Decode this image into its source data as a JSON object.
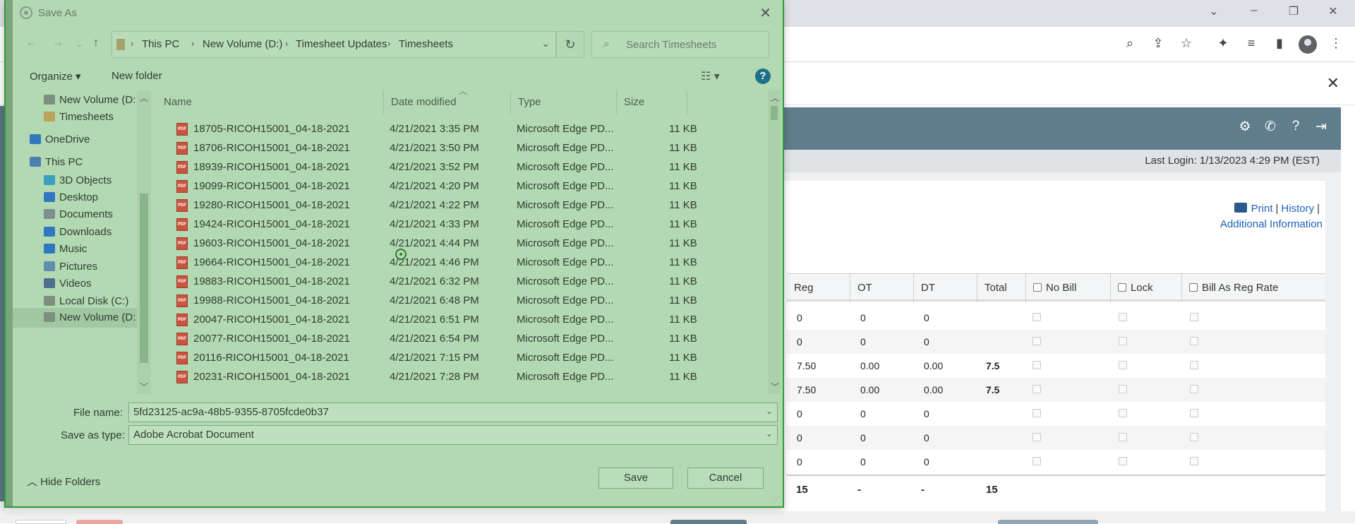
{
  "dialog": {
    "title": "Save As",
    "breadcrumb": [
      "This PC",
      "New Volume (D:)",
      "Timesheet Updates",
      "Timesheets"
    ],
    "search_placeholder": "Search Timesheets",
    "organize_label": "Organize ▾",
    "new_folder_label": "New folder",
    "nav_items": [
      {
        "label": "New Volume (D:",
        "icon": "drive-icon"
      },
      {
        "label": "Timesheets",
        "icon": "folder-icon"
      },
      {
        "label": "OneDrive",
        "icon": "cloud-icon"
      },
      {
        "label": "This PC",
        "icon": "computer-icon"
      },
      {
        "label": "3D Objects",
        "icon": "3d-objects-icon"
      },
      {
        "label": "Desktop",
        "icon": "desktop-icon"
      },
      {
        "label": "Documents",
        "icon": "documents-icon"
      },
      {
        "label": "Downloads",
        "icon": "downloads-icon"
      },
      {
        "label": "Music",
        "icon": "music-icon"
      },
      {
        "label": "Pictures",
        "icon": "pictures-icon"
      },
      {
        "label": "Videos",
        "icon": "videos-icon"
      },
      {
        "label": "Local Disk (C:)",
        "icon": "drive-icon"
      },
      {
        "label": "New Volume (D:",
        "icon": "drive-icon"
      }
    ],
    "columns": {
      "name": "Name",
      "date": "Date modified",
      "type": "Type",
      "size": "Size"
    },
    "files": [
      {
        "name": "18705-RICOH15001_04-18-2021",
        "date": "4/21/2021 3:35 PM",
        "type": "Microsoft Edge PD...",
        "size": "11 KB"
      },
      {
        "name": "18706-RICOH15001_04-18-2021",
        "date": "4/21/2021 3:50 PM",
        "type": "Microsoft Edge PD...",
        "size": "11 KB"
      },
      {
        "name": "18939-RICOH15001_04-18-2021",
        "date": "4/21/2021 3:52 PM",
        "type": "Microsoft Edge PD...",
        "size": "11 KB"
      },
      {
        "name": "19099-RICOH15001_04-18-2021",
        "date": "4/21/2021 4:20 PM",
        "type": "Microsoft Edge PD...",
        "size": "11 KB"
      },
      {
        "name": "19280-RICOH15001_04-18-2021",
        "date": "4/21/2021 4:22 PM",
        "type": "Microsoft Edge PD...",
        "size": "11 KB"
      },
      {
        "name": "19424-RICOH15001_04-18-2021",
        "date": "4/21/2021 4:33 PM",
        "type": "Microsoft Edge PD...",
        "size": "11 KB"
      },
      {
        "name": "19603-RICOH15001_04-18-2021",
        "date": "4/21/2021 4:44 PM",
        "type": "Microsoft Edge PD...",
        "size": "11 KB"
      },
      {
        "name": "19664-RICOH15001_04-18-2021",
        "date": "4/21/2021 4:46 PM",
        "type": "Microsoft Edge PD...",
        "size": "11 KB"
      },
      {
        "name": "19883-RICOH15001_04-18-2021",
        "date": "4/21/2021 6:32 PM",
        "type": "Microsoft Edge PD...",
        "size": "11 KB"
      },
      {
        "name": "19988-RICOH15001_04-18-2021",
        "date": "4/21/2021 6:48 PM",
        "type": "Microsoft Edge PD...",
        "size": "11 KB"
      },
      {
        "name": "20047-RICOH15001_04-18-2021",
        "date": "4/21/2021 6:51 PM",
        "type": "Microsoft Edge PD...",
        "size": "11 KB"
      },
      {
        "name": "20077-RICOH15001_04-18-2021",
        "date": "4/21/2021 6:54 PM",
        "type": "Microsoft Edge PD...",
        "size": "11 KB"
      },
      {
        "name": "20116-RICOH15001_04-18-2021",
        "date": "4/21/2021 7:15 PM",
        "type": "Microsoft Edge PD...",
        "size": "11 KB"
      },
      {
        "name": "20231-RICOH15001_04-18-2021",
        "date": "4/21/2021 7:28 PM",
        "type": "Microsoft Edge PD...",
        "size": "11 KB"
      }
    ],
    "file_name_label": "File name:",
    "file_name_value": "5fd23125-ac9a-48b5-9355-8705fcde0b37",
    "save_type_label": "Save as type:",
    "save_type_value": "Adobe Acrobat Document",
    "hide_folders_label": "Hide Folders",
    "save_label": "Save",
    "cancel_label": "Cancel"
  },
  "page": {
    "last_login": "Last Login: 1/13/2023 4:29 PM (EST)",
    "print_label": "Print",
    "history_label": "History",
    "additional_info_label": "Additional Information",
    "table_headers": {
      "reg": "Reg",
      "ot": "OT",
      "dt": "DT",
      "total": "Total",
      "no_bill": "No Bill",
      "lock": "Lock",
      "bill_reg": "Bill As Reg Rate"
    },
    "rows": [
      {
        "reg": "0",
        "ot": "0",
        "dt": "0",
        "total": ""
      },
      {
        "reg": "0",
        "ot": "0",
        "dt": "0",
        "total": ""
      },
      {
        "reg": "7.50",
        "ot": "0.00",
        "dt": "0.00",
        "total": "7.5"
      },
      {
        "reg": "7.50",
        "ot": "0.00",
        "dt": "0.00",
        "total": "7.5"
      },
      {
        "reg": "0",
        "ot": "0",
        "dt": "0",
        "total": ""
      },
      {
        "reg": "0",
        "ot": "0",
        "dt": "0",
        "total": ""
      },
      {
        "reg": "0",
        "ot": "0",
        "dt": "0",
        "total": ""
      }
    ],
    "totals": {
      "reg": "15",
      "ot": "-",
      "dt": "-",
      "total": "15"
    }
  },
  "colors": {
    "dialog_bg": "#b3d9b3",
    "dialog_border": "#2e9b3a",
    "app_header": "#5f7d8c",
    "link": "#1a62b8"
  }
}
